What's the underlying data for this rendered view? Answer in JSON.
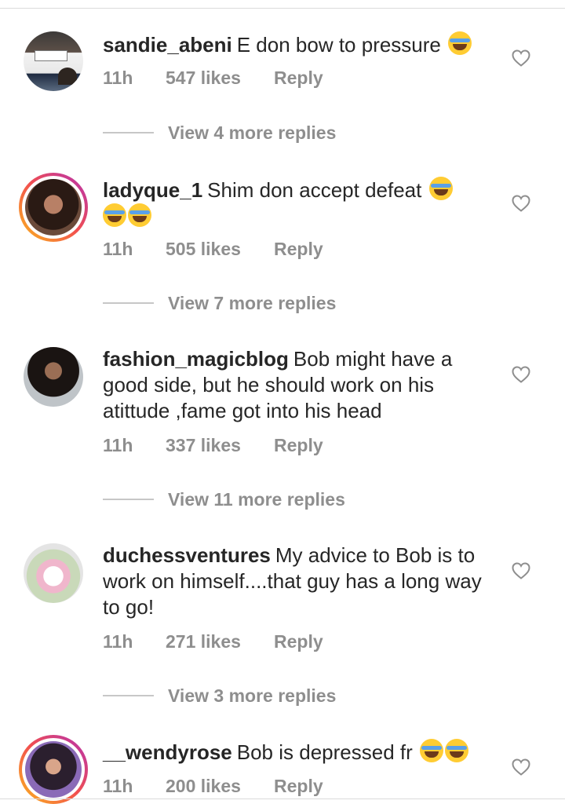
{
  "comments": [
    {
      "username": "sandie_abeni",
      "text": "E don bow to pressure",
      "emoji_count": 1,
      "time": "11h",
      "likes": "547 likes",
      "reply": "Reply",
      "view_replies": "View 4 more replies",
      "avatar_story_ring": false
    },
    {
      "username": "ladyque_1",
      "text": "Shim don accept defeat",
      "emoji_count": 3,
      "time": "11h",
      "likes": "505 likes",
      "reply": "Reply",
      "view_replies": "View 7 more replies",
      "avatar_story_ring": true
    },
    {
      "username": "fashion_magicblog",
      "text": "Bob might have a good side, but he should work on his atittude ,fame got into his head",
      "emoji_count": 0,
      "time": "11h",
      "likes": "337 likes",
      "reply": "Reply",
      "view_replies": "View 11 more replies",
      "avatar_story_ring": false
    },
    {
      "username": "duchessventures",
      "text": "My advice to Bob is to work on himself....that guy has a long way to go!",
      "emoji_count": 0,
      "time": "11h",
      "likes": "271 likes",
      "reply": "Reply",
      "view_replies": "View 3 more replies",
      "avatar_story_ring": false
    },
    {
      "username": "__wendyrose",
      "text": "Bob is depressed fr",
      "emoji_count": 2,
      "time": "11h",
      "likes": "200 likes",
      "reply": "Reply",
      "view_replies": "",
      "avatar_story_ring": true
    }
  ],
  "icons": {
    "like": "heart-outline-icon",
    "emoji": "face-with-tears-of-joy"
  },
  "colors": {
    "text": "#262626",
    "meta": "#8e8e8e",
    "story_ring_start": "#f9a326",
    "story_ring_end": "#c1379e"
  }
}
